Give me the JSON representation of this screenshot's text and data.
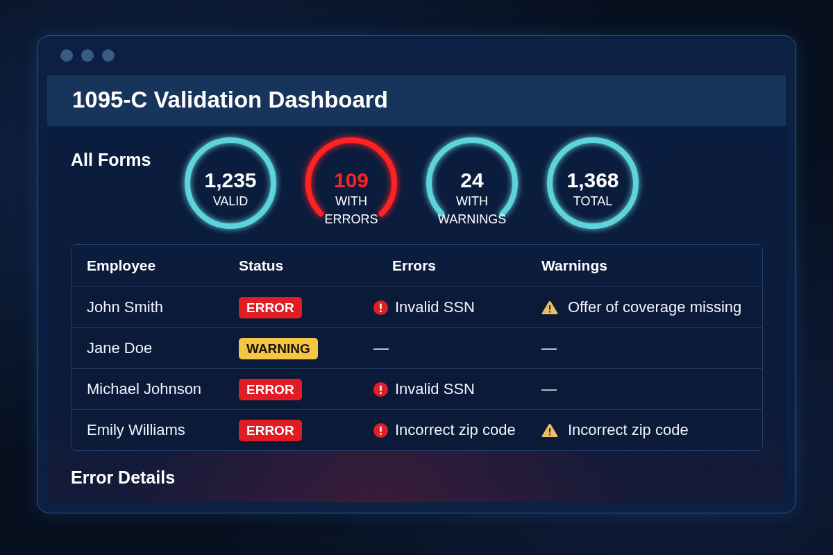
{
  "title": "1095-C Validation Dashboard",
  "summary": {
    "heading": "All Forms",
    "stats": [
      {
        "value": "1,235",
        "label": "VALID",
        "kind": "ring",
        "color": "#5fd3dc",
        "highlight": false
      },
      {
        "value": "109",
        "label": "WITH ERRORS",
        "kind": "arc",
        "color": "#ff2222",
        "highlight": true
      },
      {
        "value": "24",
        "label": "WITH WARNINGS",
        "kind": "arc",
        "color": "#5fd3dc",
        "highlight": false
      },
      {
        "value": "1,368",
        "label": "TOTAL",
        "kind": "ring",
        "color": "#5fd3dc",
        "highlight": false
      }
    ]
  },
  "table": {
    "columns": [
      "Employee",
      "Status",
      "Errors",
      "Warnings"
    ],
    "rows": [
      {
        "employee": "John Smith",
        "status": {
          "label": "ERROR",
          "kind": "error"
        },
        "errors": {
          "text": "Invalid SSN",
          "flagged": true
        },
        "warnings": {
          "text": "Offer of coverage missing",
          "flagged": true
        }
      },
      {
        "employee": "Jane Doe",
        "status": {
          "label": "WARNING",
          "kind": "warning"
        },
        "errors": {
          "text": "—",
          "flagged": false
        },
        "warnings": {
          "text": "—",
          "flagged": false
        }
      },
      {
        "employee": "Michael Johnson",
        "status": {
          "label": "ERROR",
          "kind": "error"
        },
        "errors": {
          "text": "Invalid SSN",
          "flagged": true
        },
        "warnings": {
          "text": "—",
          "flagged": false
        }
      },
      {
        "employee": "Emily Williams",
        "status": {
          "label": "ERROR",
          "kind": "error"
        },
        "errors": {
          "text": "Incorrect zip code",
          "flagged": true
        },
        "warnings": {
          "text": "Incorrect zip code",
          "flagged": true
        }
      }
    ]
  },
  "details": {
    "heading": "Error Details"
  }
}
